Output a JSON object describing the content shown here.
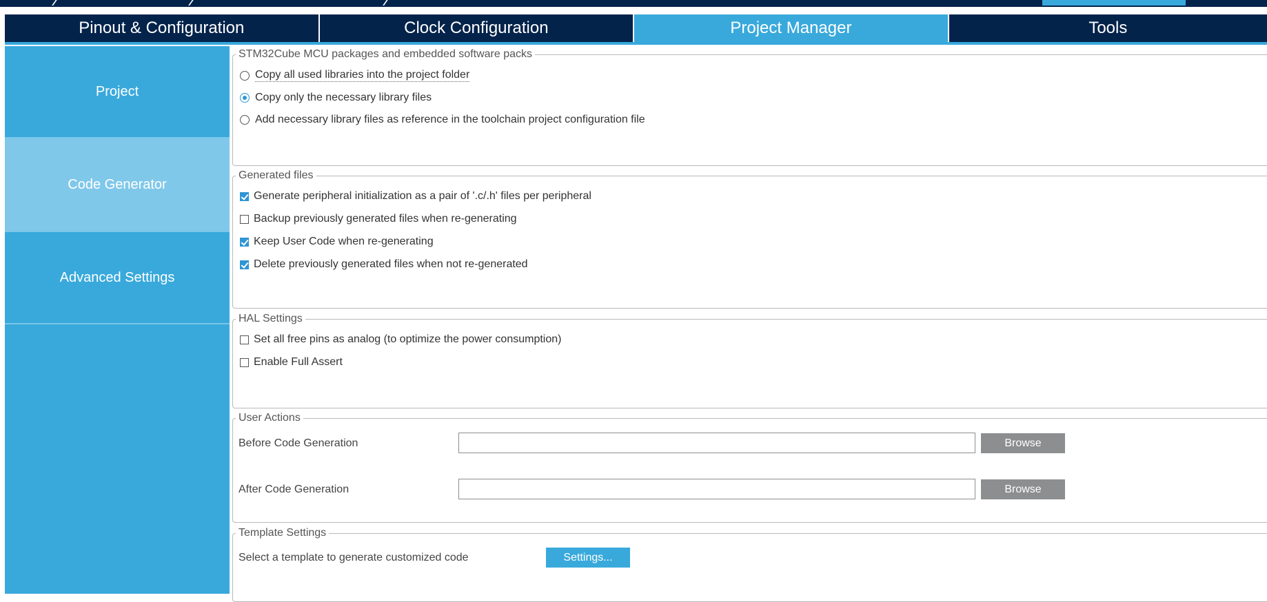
{
  "tabs": [
    {
      "label": "Pinout & Configuration",
      "active": false
    },
    {
      "label": "Clock Configuration",
      "active": false
    },
    {
      "label": "Project Manager",
      "active": true
    },
    {
      "label": "Tools",
      "active": false
    }
  ],
  "sidebar": {
    "items": [
      {
        "label": "Project",
        "active": false
      },
      {
        "label": "Code Generator",
        "active": true
      },
      {
        "label": "Advanced Settings",
        "active": false
      }
    ]
  },
  "packs": {
    "legend": "STM32Cube MCU packages and embedded software packs",
    "options": [
      {
        "label": "Copy all used libraries into the project folder",
        "selected": false
      },
      {
        "label": "Copy only the necessary library files",
        "selected": true
      },
      {
        "label": "Add necessary library files as reference in the toolchain project configuration file",
        "selected": false
      }
    ]
  },
  "generated_files": {
    "legend": "Generated files",
    "options": [
      {
        "label": "Generate peripheral initialization as a pair of '.c/.h' files per peripheral",
        "checked": true
      },
      {
        "label": "Backup previously generated files when re-generating",
        "checked": false
      },
      {
        "label": "Keep User Code when re-generating",
        "checked": true
      },
      {
        "label": "Delete previously generated files when not re-generated",
        "checked": true
      }
    ]
  },
  "hal_settings": {
    "legend": "HAL Settings",
    "options": [
      {
        "label": "Set all free pins as analog (to optimize the power consumption)",
        "checked": false
      },
      {
        "label": "Enable Full Assert",
        "checked": false
      }
    ]
  },
  "user_actions": {
    "legend": "User Actions",
    "before_label": "Before Code Generation",
    "before_value": "",
    "after_label": "After Code Generation",
    "after_value": "",
    "browse_label": "Browse"
  },
  "template_settings": {
    "legend": "Template Settings",
    "label": "Select a template to generate customized code",
    "button_label": "Settings..."
  },
  "colors": {
    "dark_navy": "#03234b",
    "accent_blue": "#39a9dc",
    "sidebar_active": "#80c8ea",
    "button_gray": "#8c8e90"
  }
}
